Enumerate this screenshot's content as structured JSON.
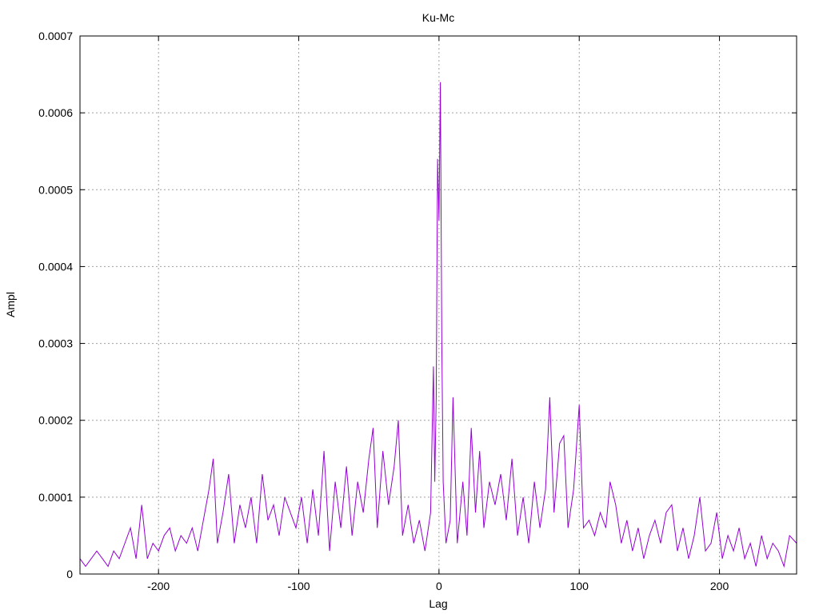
{
  "chart_data": {
    "type": "line",
    "title": "Ku-Mc",
    "xlabel": "Lag",
    "ylabel": "Ampl",
    "xlim": [
      -256,
      255
    ],
    "ylim": [
      0,
      0.0007
    ],
    "grid": true,
    "legend": "none",
    "series_color": "#9400d3",
    "xticks": [
      {
        "value": -200,
        "label": "-200"
      },
      {
        "value": -100,
        "label": "-100"
      },
      {
        "value": 0,
        "label": "0"
      },
      {
        "value": 100,
        "label": "100"
      },
      {
        "value": 200,
        "label": "200"
      }
    ],
    "yticks": [
      {
        "value": 0,
        "label": "0"
      },
      {
        "value": 0.0001,
        "label": "0.0001"
      },
      {
        "value": 0.0002,
        "label": "0.0002"
      },
      {
        "value": 0.0003,
        "label": "0.0003"
      },
      {
        "value": 0.0004,
        "label": "0.0004"
      },
      {
        "value": 0.0005,
        "label": "0.0005"
      },
      {
        "value": 0.0006,
        "label": "0.0006"
      },
      {
        "value": 0.0007,
        "label": "0.0007"
      }
    ],
    "series": [
      {
        "points": [
          [
            -256,
            2e-05
          ],
          [
            -252,
            1e-05
          ],
          [
            -248,
            2e-05
          ],
          [
            -244,
            3e-05
          ],
          [
            -240,
            2e-05
          ],
          [
            -236,
            1e-05
          ],
          [
            -232,
            3e-05
          ],
          [
            -228,
            2e-05
          ],
          [
            -224,
            4e-05
          ],
          [
            -220,
            6e-05
          ],
          [
            -216,
            2e-05
          ],
          [
            -212,
            9e-05
          ],
          [
            -208,
            2e-05
          ],
          [
            -204,
            4e-05
          ],
          [
            -200,
            3e-05
          ],
          [
            -196,
            5e-05
          ],
          [
            -192,
            6e-05
          ],
          [
            -188,
            3e-05
          ],
          [
            -184,
            5e-05
          ],
          [
            -180,
            4e-05
          ],
          [
            -176,
            6e-05
          ],
          [
            -172,
            3e-05
          ],
          [
            -168,
            7e-05
          ],
          [
            -164,
            0.00011
          ],
          [
            -161,
            0.00015
          ],
          [
            -158,
            4e-05
          ],
          [
            -154,
            8e-05
          ],
          [
            -150,
            0.00013
          ],
          [
            -146,
            4e-05
          ],
          [
            -142,
            9e-05
          ],
          [
            -138,
            6e-05
          ],
          [
            -134,
            0.0001
          ],
          [
            -130,
            4e-05
          ],
          [
            -126,
            0.00013
          ],
          [
            -122,
            7e-05
          ],
          [
            -118,
            9e-05
          ],
          [
            -114,
            5e-05
          ],
          [
            -110,
            0.0001
          ],
          [
            -106,
            8e-05
          ],
          [
            -102,
            6e-05
          ],
          [
            -98,
            0.0001
          ],
          [
            -94,
            4e-05
          ],
          [
            -90,
            0.00011
          ],
          [
            -86,
            5e-05
          ],
          [
            -82,
            0.00016
          ],
          [
            -78,
            3e-05
          ],
          [
            -74,
            0.00012
          ],
          [
            -70,
            6e-05
          ],
          [
            -66,
            0.00014
          ],
          [
            -62,
            5e-05
          ],
          [
            -58,
            0.00012
          ],
          [
            -54,
            8e-05
          ],
          [
            -50,
            0.00015
          ],
          [
            -47,
            0.00019
          ],
          [
            -44,
            6e-05
          ],
          [
            -40,
            0.00016
          ],
          [
            -36,
            9e-05
          ],
          [
            -32,
            0.00014
          ],
          [
            -29,
            0.0002
          ],
          [
            -26,
            5e-05
          ],
          [
            -22,
            9e-05
          ],
          [
            -18,
            4e-05
          ],
          [
            -14,
            7e-05
          ],
          [
            -10,
            3e-05
          ],
          [
            -6,
            8e-05
          ],
          [
            -4,
            0.00027
          ],
          [
            -3,
            0.00012
          ],
          [
            -2,
            0.00023
          ],
          [
            -1,
            0.00054
          ],
          [
            0,
            0.00046
          ],
          [
            1,
            0.00064
          ],
          [
            2,
            0.0003
          ],
          [
            3,
            0.00012
          ],
          [
            5,
            4e-05
          ],
          [
            8,
            7e-05
          ],
          [
            10,
            0.00023
          ],
          [
            13,
            4e-05
          ],
          [
            17,
            0.00012
          ],
          [
            20,
            5e-05
          ],
          [
            23,
            0.00019
          ],
          [
            26,
            8e-05
          ],
          [
            29,
            0.00016
          ],
          [
            32,
            6e-05
          ],
          [
            36,
            0.00012
          ],
          [
            40,
            9e-05
          ],
          [
            44,
            0.00013
          ],
          [
            48,
            7e-05
          ],
          [
            52,
            0.00015
          ],
          [
            56,
            5e-05
          ],
          [
            60,
            0.0001
          ],
          [
            64,
            4e-05
          ],
          [
            68,
            0.00012
          ],
          [
            72,
            6e-05
          ],
          [
            76,
            0.00011
          ],
          [
            79,
            0.00023
          ],
          [
            82,
            8e-05
          ],
          [
            86,
            0.00017
          ],
          [
            89,
            0.00018
          ],
          [
            92,
            6e-05
          ],
          [
            96,
            0.00011
          ],
          [
            100,
            0.00022
          ],
          [
            103,
            6e-05
          ],
          [
            107,
            7e-05
          ],
          [
            111,
            5e-05
          ],
          [
            115,
            8e-05
          ],
          [
            119,
            6e-05
          ],
          [
            122,
            0.00012
          ],
          [
            126,
            9e-05
          ],
          [
            130,
            4e-05
          ],
          [
            134,
            7e-05
          ],
          [
            138,
            3e-05
          ],
          [
            142,
            6e-05
          ],
          [
            146,
            2e-05
          ],
          [
            150,
            5e-05
          ],
          [
            154,
            7e-05
          ],
          [
            158,
            4e-05
          ],
          [
            162,
            8e-05
          ],
          [
            166,
            9e-05
          ],
          [
            170,
            3e-05
          ],
          [
            174,
            6e-05
          ],
          [
            178,
            2e-05
          ],
          [
            182,
            5e-05
          ],
          [
            186,
            0.0001
          ],
          [
            190,
            3e-05
          ],
          [
            194,
            4e-05
          ],
          [
            198,
            8e-05
          ],
          [
            202,
            2e-05
          ],
          [
            206,
            5e-05
          ],
          [
            210,
            3e-05
          ],
          [
            214,
            6e-05
          ],
          [
            218,
            2e-05
          ],
          [
            222,
            4e-05
          ],
          [
            226,
            1e-05
          ],
          [
            230,
            5e-05
          ],
          [
            234,
            2e-05
          ],
          [
            238,
            4e-05
          ],
          [
            242,
            3e-05
          ],
          [
            246,
            1e-05
          ],
          [
            250,
            5e-05
          ],
          [
            255,
            4e-05
          ]
        ]
      }
    ]
  }
}
